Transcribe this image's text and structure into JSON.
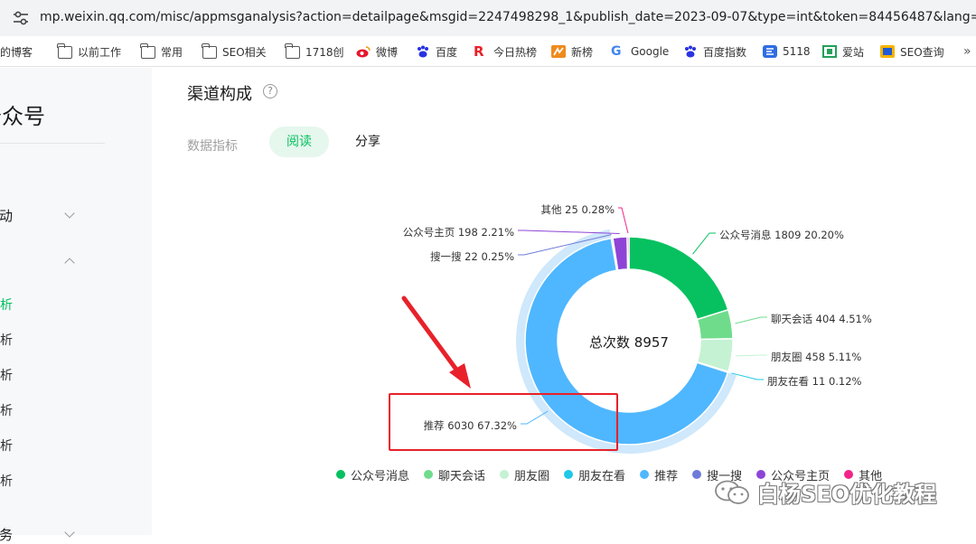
{
  "browser": {
    "url": "mp.weixin.qq.com/misc/appmsganalysis?action=detailpage&msgid=2247498298_1&publish_date=2023-09-07&type=int&token=84456487&lang=zh_CN",
    "bookmarks": [
      "我的博客",
      "以前工作",
      "常用",
      "SEO相关",
      "1718创",
      "微博",
      "百度",
      "今日热榜",
      "新榜",
      "Google",
      "百度指数",
      "5118",
      "爱站",
      "SEO查询"
    ]
  },
  "sidebar": {
    "title": "公众号",
    "items": [
      {
        "label": "互动",
        "expanded": false
      },
      {
        "label": "",
        "expanded": true
      }
    ],
    "sub_items": [
      "分析",
      "分析",
      "分析",
      "分析",
      "分析",
      "分析"
    ],
    "footer": "服务"
  },
  "main": {
    "title": "渠道构成",
    "metric_label": "数据指标",
    "tabs": [
      {
        "label": "阅读",
        "active": true
      },
      {
        "label": "分享",
        "active": false
      }
    ]
  },
  "chart_data": {
    "type": "pie",
    "style": "donut",
    "center_label": "总次数",
    "total": 8957,
    "slices": [
      {
        "name": "公众号消息",
        "value": 1809,
        "percent": "20.20%",
        "color": "#07c160"
      },
      {
        "name": "聊天会话",
        "value": 404,
        "percent": "4.51%",
        "color": "#6fdc8c"
      },
      {
        "name": "朋友圈",
        "value": 458,
        "percent": "5.11%",
        "color": "#c4f2d2"
      },
      {
        "name": "朋友在看",
        "value": 11,
        "percent": "0.12%",
        "color": "#1ec8e6"
      },
      {
        "name": "推荐",
        "value": 6030,
        "percent": "67.32%",
        "color": "#4fb7ff"
      },
      {
        "name": "搜一搜",
        "value": 22,
        "percent": "0.25%",
        "color": "#6f7bd8"
      },
      {
        "name": "公众号主页",
        "value": 198,
        "percent": "2.21%",
        "color": "#8e44d6"
      },
      {
        "name": "其他",
        "value": 25,
        "percent": "0.28%",
        "color": "#f2248a"
      }
    ],
    "legend": [
      "公众号消息",
      "聊天会话",
      "朋友圈",
      "朋友在看",
      "推荐",
      "搜一搜",
      "公众号主页",
      "其他"
    ],
    "legend_position": "bottom"
  },
  "annotation": {
    "arrow_color": "#e8212a",
    "highlight_color": "#e8212a"
  },
  "watermark": {
    "text": "白杨SEO优化教程"
  }
}
